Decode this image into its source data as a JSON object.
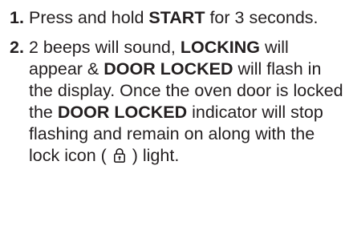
{
  "steps": [
    {
      "number": "1.",
      "parts": {
        "a": "Press and hold ",
        "b": "START",
        "c": " for 3 seconds."
      }
    },
    {
      "number": "2.",
      "parts": {
        "a": "2 beeps will sound, ",
        "b": "LOCKING",
        "c": " will appear & ",
        "d": "DOOR LOCKED",
        "e": " will flash in the display. Once the oven door is locked the ",
        "f": "DOOR LOCKED",
        "g": " indicator will stop flashing and remain on along with the lock icon ( ",
        "icon": "lock-icon",
        "h": " ) light."
      }
    }
  ]
}
